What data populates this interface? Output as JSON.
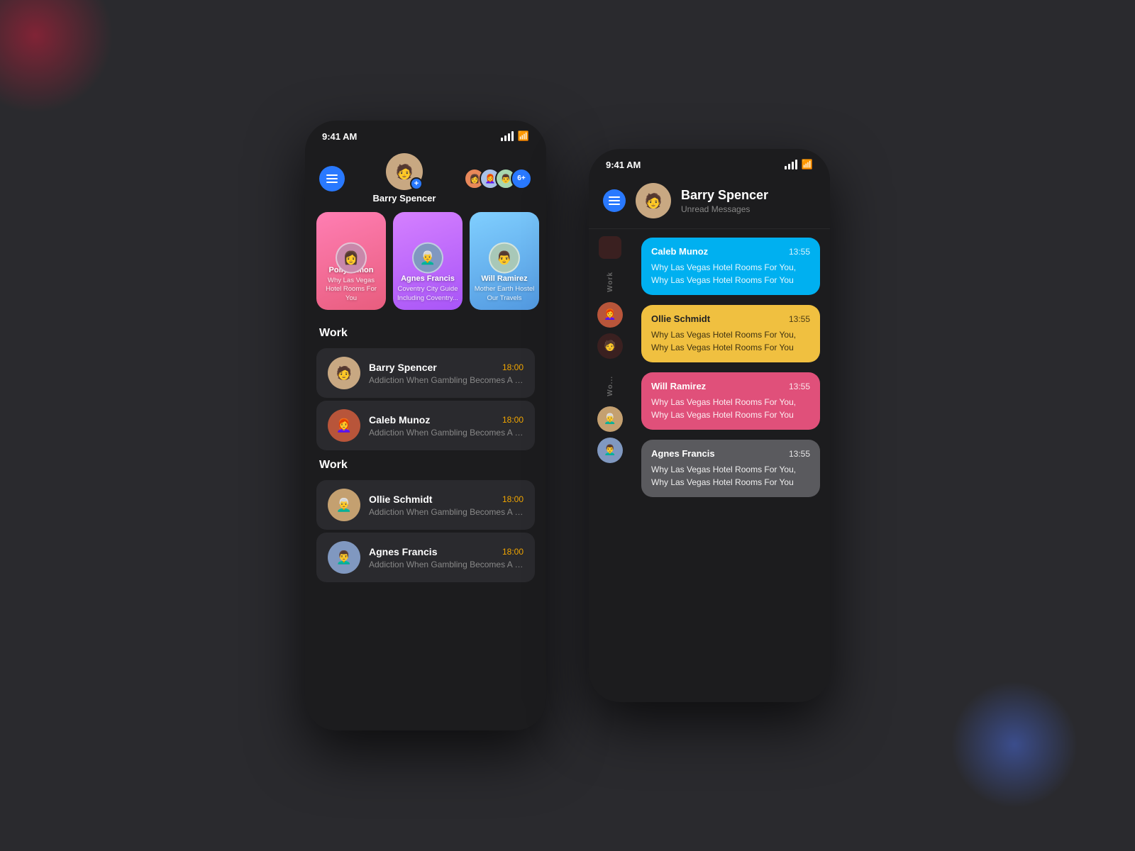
{
  "background": {
    "color": "#2a2a2e"
  },
  "left_phone": {
    "status_bar": {
      "time": "9:41 AM"
    },
    "header": {
      "menu_label": "menu",
      "profile_name": "Barry Spencer",
      "add_badge": "+",
      "more_count": "6+"
    },
    "stories": [
      {
        "name": "Polly Simon",
        "desc": "Why Las Vegas Hotel Rooms For You",
        "bg": "pink",
        "emoji": "👩"
      },
      {
        "name": "Agnes Francis",
        "desc": "Coventry City Guide Including Coventry...",
        "bg": "purple",
        "emoji": "👨‍🦳"
      },
      {
        "name": "Will Ramirez",
        "desc": "Mother Earth Hostel Our Travels",
        "bg": "blue",
        "emoji": "👨"
      }
    ],
    "sections": [
      {
        "label": "Work",
        "messages": [
          {
            "name": "Barry Spencer",
            "time": "18:00",
            "preview": "Addiction When Gambling Becomes A Pr...",
            "emoji": "👨"
          },
          {
            "name": "Caleb Munoz",
            "time": "18:00",
            "preview": "Addiction When Gambling Becomes A Pr...",
            "emoji": "👩‍🦰"
          }
        ]
      },
      {
        "label": "Work",
        "messages": [
          {
            "name": "Ollie Schmidt",
            "time": "18:00",
            "preview": "Addiction When Gambling Becomes A Pr...",
            "emoji": "👨‍🦳"
          },
          {
            "name": "Agnes Francis",
            "time": "18:00",
            "preview": "Addiction When Gambling Becomes A Pr...",
            "emoji": "👨‍🦱"
          }
        ]
      }
    ]
  },
  "right_phone": {
    "status_bar": {
      "time": "9:41 AM"
    },
    "header": {
      "profile_name": "Barry Spencer",
      "sub_text": "Unread Messages",
      "emoji": "👨"
    },
    "sidebar": {
      "sections": [
        {
          "label": "Work",
          "avatars": [
            {
              "emoji": "👩‍🦰",
              "dark": false
            },
            {
              "emoji": "👨",
              "dark": true
            }
          ]
        },
        {
          "label": "Wo...",
          "avatars": [
            {
              "emoji": "👨‍🦳",
              "dark": false
            },
            {
              "emoji": "👨‍🦱",
              "dark": false
            }
          ]
        }
      ]
    },
    "messages": [
      {
        "name": "Caleb Munoz",
        "time": "13:55",
        "text": "Why Las Vegas Hotel Rooms For You, Why Las Vegas Hotel Rooms For You",
        "color": "blue"
      },
      {
        "name": "Ollie Schmidt",
        "time": "13:55",
        "text": "Why Las Vegas Hotel Rooms For You, Why Las Vegas Hotel Rooms For You",
        "color": "yellow"
      },
      {
        "name": "Will Ramirez",
        "time": "13:55",
        "text": "Why Las Vegas Hotel Rooms For You, Why Las Vegas Hotel Rooms For You",
        "color": "pink"
      },
      {
        "name": "Agnes Francis",
        "time": "13:55",
        "text": "Why Las Vegas Hotel Rooms For You, Why Las Vegas Hotel Rooms For You",
        "color": "gray"
      }
    ]
  }
}
